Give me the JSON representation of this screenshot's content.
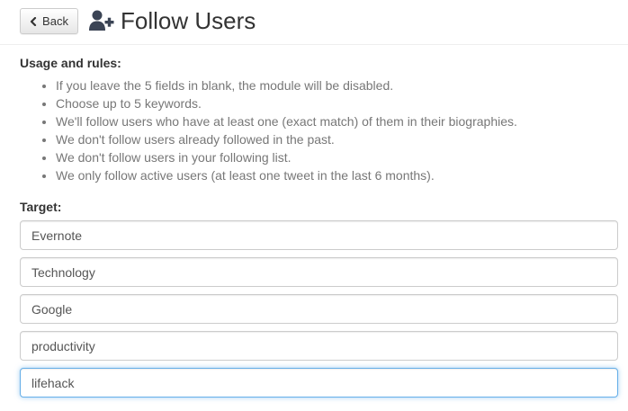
{
  "header": {
    "back_label": "Back",
    "title": "Follow Users",
    "title_icon": "user-plus-icon",
    "back_icon": "chevron-left-icon"
  },
  "rules": {
    "heading": "Usage and rules:",
    "items": [
      "If you leave the 5 fields in blank, the module will be disabled.",
      "Choose up to 5 keywords.",
      "We'll follow users who have at least one (exact match) of them in their biographies.",
      "We don't follow users already followed in the past.",
      "We don't follow users in your following list.",
      "We only follow active users (at least one tweet in the last 6 months)."
    ]
  },
  "target": {
    "label": "Target:",
    "fields": [
      "Evernote",
      "Technology",
      "Google",
      "productivity",
      "lifehack"
    ],
    "focused_index": 4
  },
  "colors": {
    "focus_border": "#66afe9",
    "muted_text": "#777777",
    "text": "#333333"
  }
}
